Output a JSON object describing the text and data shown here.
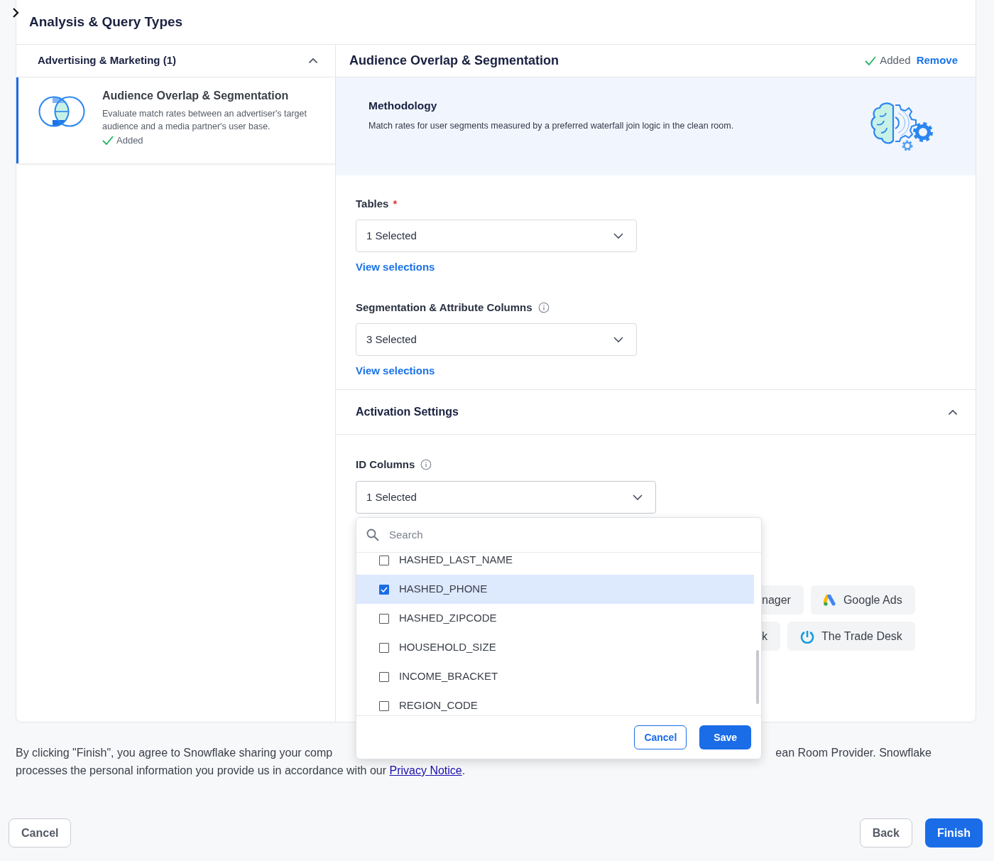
{
  "panel": {
    "title": "Analysis & Query Types"
  },
  "categories": [
    {
      "label": "Advertising & Marketing (1)",
      "expanded": true,
      "items": [
        {
          "title": "Audience Overlap & Segmentation",
          "description": "Evaluate match rates between an advertiser's target audience and a media partner's user base.",
          "status": "Added",
          "selected": true
        }
      ]
    }
  ],
  "detail": {
    "title": "Audience Overlap & Segmentation",
    "status": "Added",
    "action": "Remove",
    "methodology": {
      "title": "Methodology",
      "text": "Match rates for user segments measured by a preferred waterfall join logic in the clean room."
    },
    "fields": [
      {
        "label": "Tables",
        "required_mark": "*",
        "info": false,
        "value": "1 Selected",
        "link": "View selections"
      },
      {
        "label": "Segmentation & Attribute Columns",
        "info": true,
        "value": "3 Selected",
        "link": "View selections"
      }
    ],
    "activation": {
      "title": "Activation Settings",
      "expanded": true,
      "id_columns": {
        "label": "ID Columns",
        "info": true,
        "value": "1 Selected",
        "open": true
      },
      "dropdown": {
        "placeholder": "Search",
        "options": [
          {
            "label": "HASHED_LAST_NAME",
            "checked": false
          },
          {
            "label": "HASHED_PHONE",
            "checked": true
          },
          {
            "label": "HASHED_ZIPCODE",
            "checked": false
          },
          {
            "label": "HOUSEHOLD_SIZE",
            "checked": false
          },
          {
            "label": "INCOME_BRACKET",
            "checked": false
          },
          {
            "label": "REGION_CODE",
            "checked": false
          }
        ],
        "cancel": "Cancel",
        "save": "Save"
      },
      "destinations": [
        [
          {
            "label": "nager",
            "kind": "plain"
          },
          {
            "label": "Google Ads",
            "kind": "google"
          }
        ],
        [
          {
            "label": "k",
            "kind": "plain"
          },
          {
            "label": "The Trade Desk",
            "kind": "tradedesk"
          }
        ]
      ]
    }
  },
  "consent": {
    "line1_start": "By clicking \"Finish\", you agree to Snowflake sharing your comp",
    "line1_end": "ean Room Provider. Snowflake",
    "line2": "processes the personal information you provide us in accordance with our",
    "link": "Privacy Notice",
    "end": "."
  },
  "footer": {
    "cancel": "Cancel",
    "back": "Back",
    "finish": "Finish"
  }
}
